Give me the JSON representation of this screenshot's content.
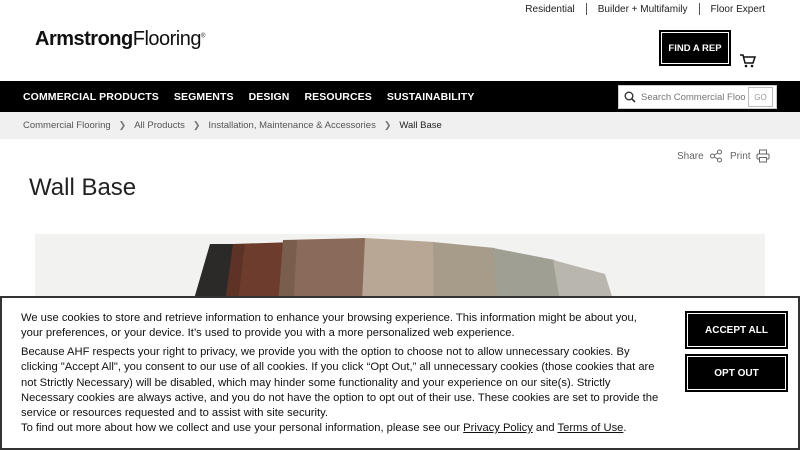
{
  "top_links": [
    "Residential",
    "Builder + Multifamily",
    "Floor Expert"
  ],
  "logo": {
    "bold": "Armstrong",
    "light": "Flooring",
    "mark": "®"
  },
  "header": {
    "find_rep": "FIND A REP"
  },
  "nav": [
    "COMMERCIAL PRODUCTS",
    "SEGMENTS",
    "DESIGN",
    "RESOURCES",
    "SUSTAINABILITY"
  ],
  "search": {
    "placeholder": "Search Commercial Floo",
    "go": "GO"
  },
  "breadcrumb": [
    "Commercial Flooring",
    "All Products",
    "Installation, Maintenance & Accessories",
    "Wall Base"
  ],
  "actions": {
    "share": "Share",
    "print": "Print"
  },
  "page_title": "Wall Base",
  "hero_swatch_colors": [
    "#2b2a28",
    "#6e3c2c",
    "#8a6a58",
    "#b9a796",
    "#a79c8a",
    "#9f9f94",
    "#b9b6ae"
  ],
  "cookie": {
    "p1": "We use cookies to store and retrieve information to enhance your browsing experience. This information might be about you, your preferences, or your device. It’s used to provide you with a more personalized web experience.",
    "p2": "Because AHF respects your right to privacy, we provide you with the option to choose not to allow unnecessary cookies. By clicking \"Accept All\", you consent to our use of all cookies. If you click “Opt Out,” all unnecessary cookies (those cookies that are not Strictly Necessary) will be disabled, which may hinder some functionality and your experience on our site(s). Strictly Necessary cookies are always active, and you do not have the option to opt out of their use. These cookies are set to provide the service or resources requested and to assist with site security.",
    "p3_prefix": "To find out more about how we collect and use your personal information, please see our ",
    "privacy_link": "Privacy Policy",
    "p3_and": " and ",
    "terms_link": "Terms of Use",
    "p3_suffix": ".",
    "accept": "ACCEPT ALL",
    "opt_out": "OPT OUT"
  }
}
